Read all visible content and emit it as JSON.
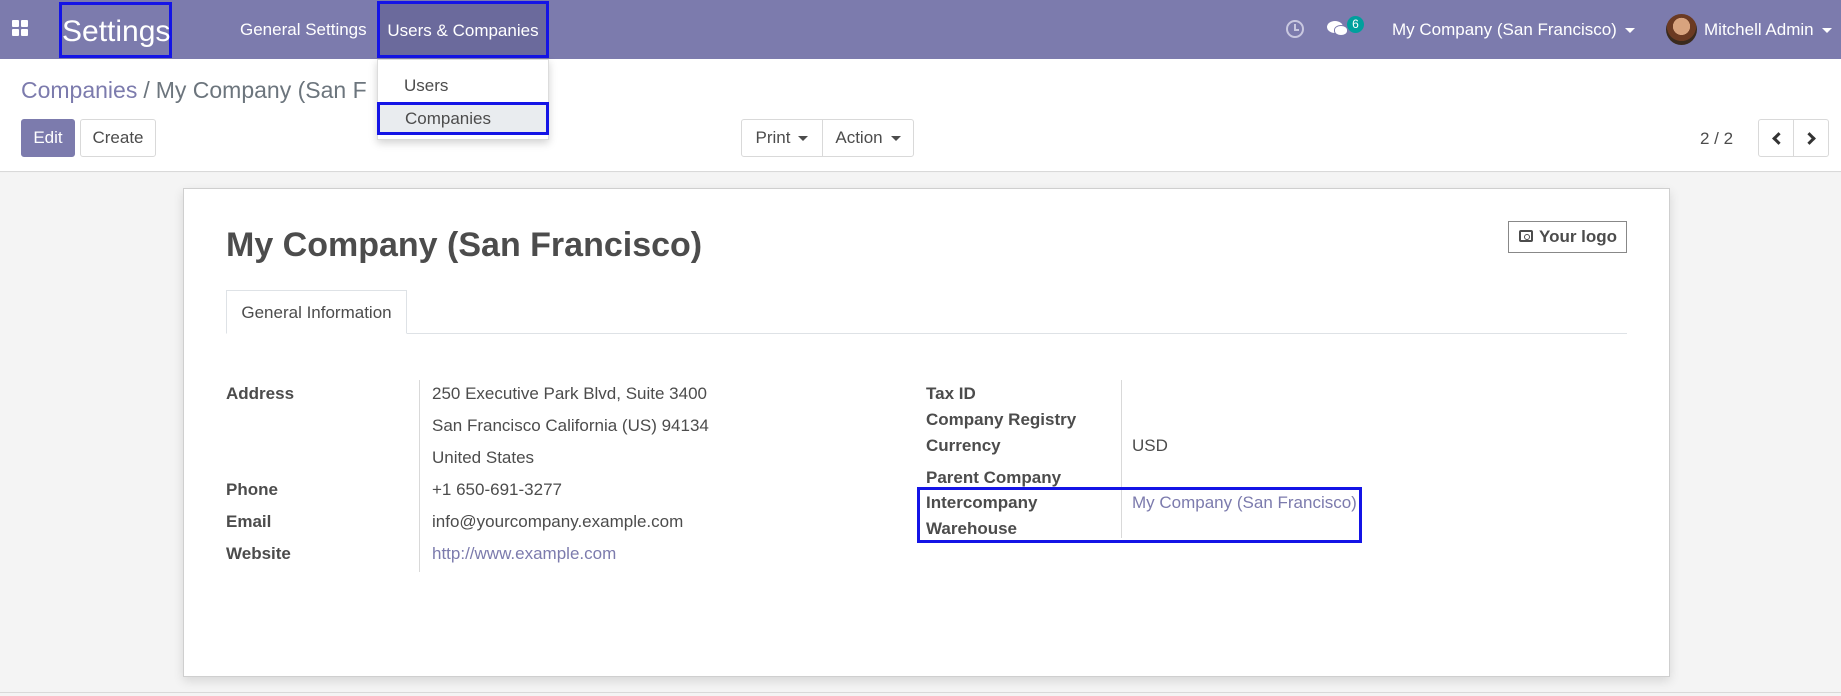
{
  "navbar": {
    "app_title": "Settings",
    "menu": {
      "general": "General Settings",
      "users_companies": "Users & Companies"
    },
    "chat_count": "6",
    "company": "My Company (San Francisco)",
    "user": "Mitchell Admin"
  },
  "dropdown": {
    "items": [
      "Users",
      "Companies"
    ]
  },
  "breadcrumb": {
    "parent": "Companies",
    "separator": "/",
    "current": "My Company (San F"
  },
  "buttons": {
    "edit": "Edit",
    "create": "Create",
    "print": "Print",
    "action": "Action"
  },
  "pager": {
    "value": "2 / 2"
  },
  "form": {
    "title": "My Company (San Francisco)",
    "logo": "Your logo",
    "tab": "General Information",
    "left": {
      "address_label": "Address",
      "address_line1": "250 Executive Park Blvd, Suite 3400",
      "address_line2": "San Francisco  California (US)  94134",
      "address_line3": "United States",
      "phone_label": "Phone",
      "phone": "+1 650-691-3277",
      "email_label": "Email",
      "email": "info@yourcompany.example.com",
      "website_label": "Website",
      "website": "http://www.example.com"
    },
    "right": {
      "tax_id_label": "Tax ID",
      "registry_label": "Company Registry",
      "currency_label": "Currency",
      "currency": "USD",
      "parent_label": "Parent Company",
      "warehouse_label_1": "Intercompany",
      "warehouse_label_2": "Warehouse",
      "warehouse": "My Company (San Francisco)"
    }
  },
  "colors": {
    "navbar": "#7c7bad",
    "highlight": "#1414e6",
    "badge": "#00a09d"
  }
}
